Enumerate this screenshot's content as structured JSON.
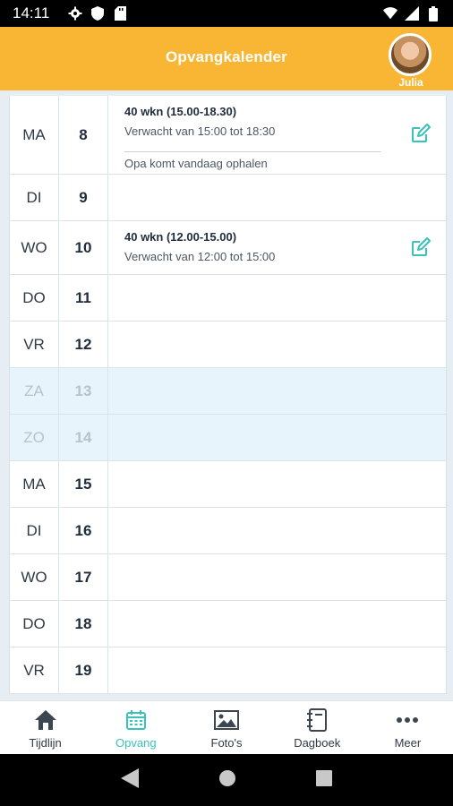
{
  "status_bar": {
    "time": "14:11"
  },
  "header": {
    "title": "Opvangkalender",
    "user_name": "Julia"
  },
  "colors": {
    "accent": "#F9B634",
    "teal": "#38C2BA",
    "weekend_bg": "#E8F4FB"
  },
  "calendar": {
    "days": [
      {
        "weekday": "MA",
        "date": "8",
        "weekend": false,
        "height": 88,
        "event": {
          "title": "40 wkn (15.00-18.30)",
          "expected": "Verwacht van 15:00 tot 18:30",
          "note": "Opa komt vandaag ophalen"
        }
      },
      {
        "weekday": "DI",
        "date": "9",
        "weekend": false,
        "height": 52
      },
      {
        "weekday": "WO",
        "date": "10",
        "weekend": false,
        "height": 60,
        "event": {
          "title": "40 wkn (12.00-15.00)",
          "expected": "Verwacht van 12:00 tot 15:00"
        }
      },
      {
        "weekday": "DO",
        "date": "11",
        "weekend": false,
        "height": 52
      },
      {
        "weekday": "VR",
        "date": "12",
        "weekend": false,
        "height": 52
      },
      {
        "weekday": "ZA",
        "date": "13",
        "weekend": true,
        "height": 52
      },
      {
        "weekday": "ZO",
        "date": "14",
        "weekend": true,
        "height": 52
      },
      {
        "weekday": "MA",
        "date": "15",
        "weekend": false,
        "height": 52
      },
      {
        "weekday": "DI",
        "date": "16",
        "weekend": false,
        "height": 52
      },
      {
        "weekday": "WO",
        "date": "17",
        "weekend": false,
        "height": 52
      },
      {
        "weekday": "DO",
        "date": "18",
        "weekend": false,
        "height": 52
      },
      {
        "weekday": "VR",
        "date": "19",
        "weekend": false,
        "height": 52
      }
    ]
  },
  "bottom_nav": {
    "items": [
      {
        "label": "Tijdlijn",
        "icon": "home-icon"
      },
      {
        "label": "Opvang",
        "icon": "calendar-icon",
        "active": true
      },
      {
        "label": "Foto's",
        "icon": "image-icon"
      },
      {
        "label": "Dagboek",
        "icon": "notebook-icon"
      },
      {
        "label": "Meer",
        "icon": "more-icon"
      }
    ]
  }
}
